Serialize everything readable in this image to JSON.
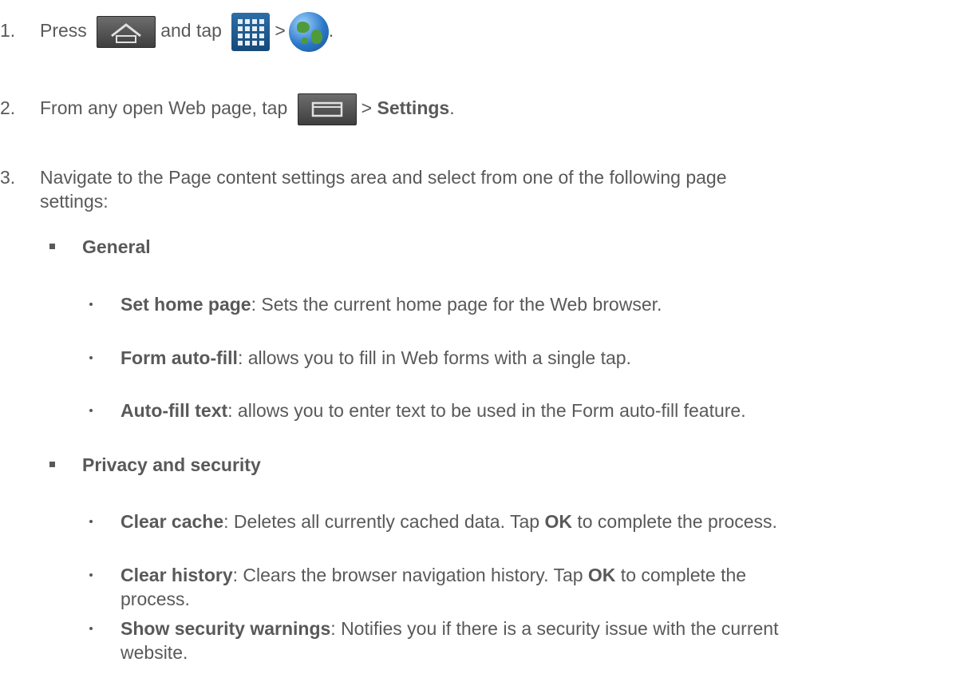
{
  "steps": [
    {
      "num": "1.",
      "t1": "Press",
      "t2": "and tap",
      "t3": ">",
      "t4": "."
    },
    {
      "num": "2.",
      "t1": "From any open Web page, tap",
      "t2": ">",
      "bold": "Settings",
      "t3": "."
    },
    {
      "num": "3.",
      "line1": "Navigate to the Page content settings area and select from one of the following page",
      "line2": "settings:"
    }
  ],
  "sections": [
    {
      "title": "General",
      "items": [
        {
          "term": "Set home page",
          "desc": ": Sets the current home page for the Web browser."
        },
        {
          "term": "Form auto-fill",
          "desc": ": allows you to fill in Web forms with a single tap."
        },
        {
          "term": "Auto-fill text",
          "desc": ": allows you to enter text to be used in the Form auto-fill feature."
        }
      ]
    },
    {
      "title": "Privacy and security",
      "items": [
        {
          "term": "Clear cache",
          "desc": ": Deletes all currently cached data. Tap ",
          "ok": "OK",
          "desc2": " to complete the process."
        },
        {
          "term": "Clear history",
          "desc": ": Clears the browser navigation history. Tap ",
          "ok": "OK",
          "desc2": " to complete the",
          "cont": "process."
        },
        {
          "term": "Show security warnings",
          "desc": ": Notifies you if there is a security issue with the current",
          "cont": "website."
        }
      ]
    }
  ],
  "icons": {
    "home": "home-key-icon",
    "apps": "apps-icon",
    "browser": "browser-globe-icon",
    "menu": "menu-key-icon"
  }
}
